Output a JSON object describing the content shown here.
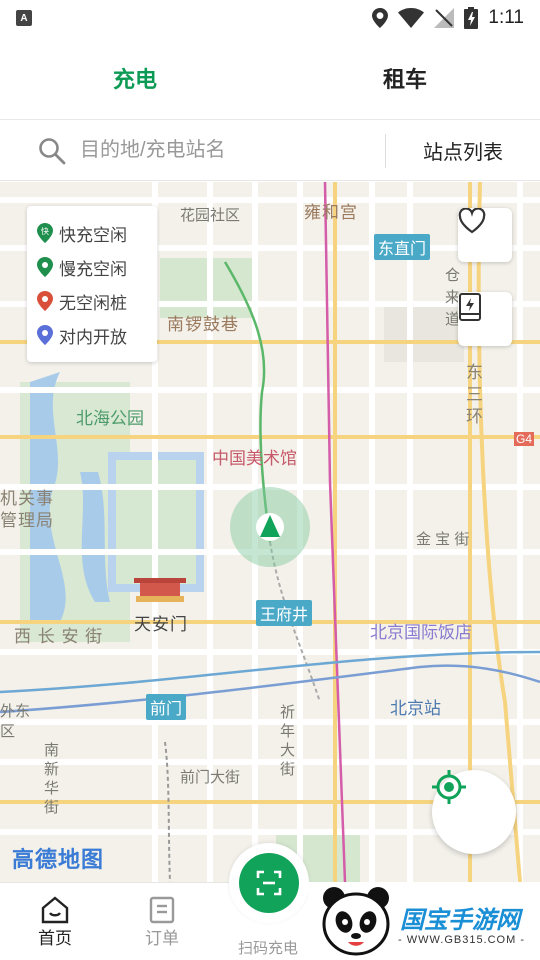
{
  "status_bar": {
    "time": "1:11",
    "notif_letter": "A"
  },
  "tabs": [
    {
      "label": "充电",
      "active": true
    },
    {
      "label": "租车",
      "active": false
    }
  ],
  "search": {
    "placeholder": "目的地/充电站名",
    "station_list": "站点列表"
  },
  "legend": [
    {
      "label": "快充空闲",
      "color": "#1f8f4e",
      "glyph": "快"
    },
    {
      "label": "慢充空闲",
      "color": "#1f8f4e",
      "glyph": ""
    },
    {
      "label": "无空闲桩",
      "color": "#d9503a",
      "glyph": ""
    },
    {
      "label": "对内开放",
      "color": "#5a6fd8",
      "glyph": ""
    }
  ],
  "map": {
    "labels": {
      "huayuan": "花园社区",
      "yonghegong": "雍和宫",
      "dongzhimen": "东直门",
      "cang": "仓",
      "lai": "来",
      "dao": "道",
      "nanluoguxiang": "南锣鼓巷",
      "dongsan": "东",
      "sanhuan_a": "三",
      "sanhuan_b": "环",
      "beihai": "北海公园",
      "meishuguan": "中国美术馆",
      "jiguan_a": "机关事",
      "jiguan_b": "管理局",
      "jinbao": "金 宝 街",
      "tiananmen": "天安门",
      "wangfujing": "王府井",
      "beijing_hotel": "北京国际饭店",
      "xichangan": "西 长 安 街",
      "qianmen_metro": "前门",
      "beijingzhan": "北京站",
      "waidong": "外东",
      "qu": "区",
      "nanxinhua": "南新华街",
      "qiannian": "祈年大街",
      "qianmendajie": "前门大街",
      "ring_badge": "G4"
    },
    "logo": "高德地图"
  },
  "bottom_nav": {
    "home": "首页",
    "orders": "订单",
    "scan": "扫码充电"
  },
  "watermark": {
    "brand": "国宝手游网",
    "url": "- WWW.GB315.COM -"
  },
  "colors": {
    "accent": "#0c9a55",
    "brand_green": "#12a35a"
  }
}
